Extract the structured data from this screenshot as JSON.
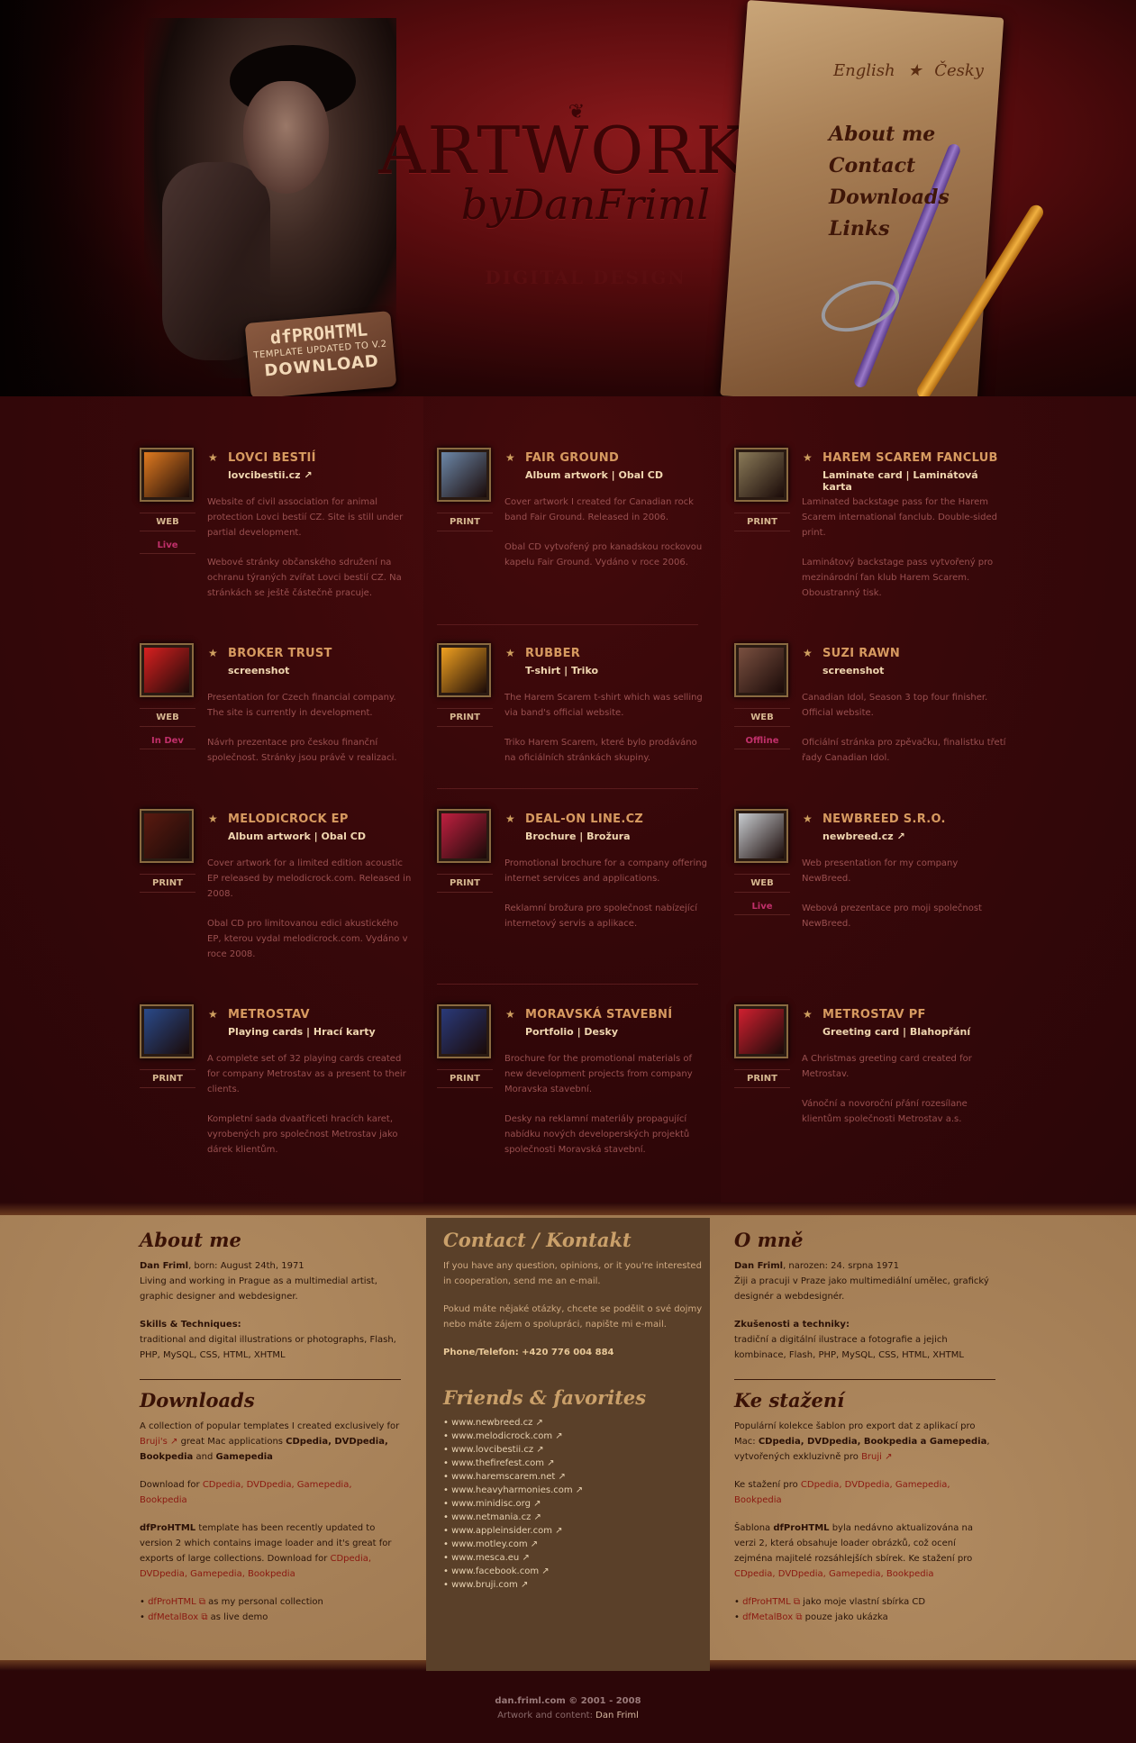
{
  "header": {
    "logo": "ARTWORKS",
    "by": "byDanFriml",
    "subtitle": "DIGITAL DESIGN",
    "tag_line1": "dfPROHTML",
    "tag_line2": "TEMPLATE UPDATED TO V.2",
    "tag_line3": "DOWNLOAD",
    "lang_en": "English",
    "lang_star": "★",
    "lang_cz": "Česky",
    "nav": [
      "About me",
      "Contact",
      "Downloads",
      "Links"
    ]
  },
  "works": [
    {
      "title": "LOVCI BESTIÍ",
      "sub": "lovcibestii.cz ↗",
      "kind": "WEB",
      "status": "Live",
      "thumb_color": "#e07a20",
      "icon": "warning-sign-icon",
      "desc": [
        "Website of civil association for animal protection Lovci bestií CZ. Site is still under partial development.",
        "Webové stránky občanského sdružení na ochranu týraných zvířat Lovci bestií CZ. Na stránkách se ještě částečně pracuje."
      ]
    },
    {
      "title": "FAIR GROUND",
      "sub": "Album artwork | Obal CD",
      "kind": "PRINT",
      "status": "",
      "thumb_color": "#6c87a8",
      "icon": "mask-icon",
      "desc": [
        "Cover artwork I created for Canadian rock band Fair Ground. Released in 2006.",
        "Obal CD vytvořený pro kanadskou rockovou kapelu Fair Ground. Vydáno v roce 2006."
      ]
    },
    {
      "title": "HAREM SCAREM FANCLUB",
      "sub": "Laminate card | Laminátová karta",
      "kind": "PRINT",
      "status": "",
      "thumb_color": "#8a7a58",
      "icon": "emblem-icon",
      "desc": [
        "Laminated backstage pass for the Harem Scarem international fanclub. Double-sided print.",
        "Laminátový backstage pass vytvořený pro mezinárodní fan klub Harem Scarem. Oboustranný tisk."
      ]
    },
    {
      "title": "BROKER TRUST",
      "sub": "screenshot",
      "kind": "WEB",
      "status": "In Dev",
      "thumb_color": "#d82020",
      "icon": "broker-logo-icon",
      "desc": [
        "Presentation for Czech financial company. The site is currently in development.",
        "Návrh prezentace pro českou finanční společnost. Stránky jsou právě v realizaci."
      ]
    },
    {
      "title": "RUBBER",
      "sub": "T-shirt | Triko",
      "kind": "PRINT",
      "status": "",
      "thumb_color": "#f0a020",
      "icon": "rubber-duck-icon",
      "desc": [
        "The Harem Scarem t-shirt which was selling via band's official website.",
        "Triko Harem Scarem, které bylo prodáváno na oficiálních stránkách skupiny."
      ]
    },
    {
      "title": "SUZI RAWN",
      "sub": "screenshot",
      "kind": "WEB",
      "status": "Offline",
      "thumb_color": "#7a5040",
      "icon": "portrait-icon",
      "desc": [
        "Canadian Idol, Season 3 top four finisher. Official website.",
        "Oficiální stránka pro zpěvačku, finalistku třetí řady Canadian Idol."
      ]
    },
    {
      "title": "MELODICROCK EP",
      "sub": "Album artwork | Obal CD",
      "kind": "PRINT",
      "status": "",
      "thumb_color": "#5a1a10",
      "icon": "ep-cover-icon",
      "desc": [
        "Cover artwork for a limited edition acoustic EP released by melodicrock.com. Released in 2008.",
        "Obal CD pro limitovanou edici akustického EP, kterou vydal melodicrock.com. Vydáno v roce 2008."
      ]
    },
    {
      "title": "DEAL-ON LINE.CZ",
      "sub": "Brochure | Brožura",
      "kind": "PRINT",
      "status": "",
      "thumb_color": "#c02040",
      "icon": "brochure-icon",
      "desc": [
        "Promotional brochure for a company offering internet services and applications.",
        "Reklamní brožura pro společnost nabízející internetový servis a aplikace."
      ]
    },
    {
      "title": "NEWBREED S.R.O.",
      "sub": "newbreed.cz ↗",
      "kind": "WEB",
      "status": "Live",
      "thumb_color": "#c8ccd0",
      "icon": "figure-icon",
      "desc": [
        "Web presentation for my company NewBreed.",
        "Webová prezentace pro moji společnost NewBreed."
      ]
    },
    {
      "title": "METROSTAV",
      "sub": "Playing cards | Hrací karty",
      "kind": "PRINT",
      "status": "",
      "thumb_color": "#2a4a8a",
      "icon": "building-icon",
      "desc": [
        "A complete set of 32 playing cards created for company Metrostav as a present to their clients.",
        "Kompletní sada dvaatřiceti hracích karet, vyrobených pro společnost Metrostav jako dárek klientům."
      ]
    },
    {
      "title": "MORAVSKÁ STAVEBNÍ",
      "sub": "Portfolio | Desky",
      "kind": "PRINT",
      "status": "",
      "thumb_color": "#2a3a7a",
      "icon": "portfolio-icon",
      "desc": [
        "Brochure for the promotional materials of new development projects from company Moravska stavební.",
        "Desky na reklamní materiály propagující nabídku nových developerských projektů společnosti Moravská stavební."
      ]
    },
    {
      "title": "METROSTAV PF",
      "sub": "Greeting card | Blahopřání",
      "kind": "PRINT",
      "status": "",
      "thumb_color": "#d02030",
      "icon": "greeting-card-icon",
      "desc": [
        "A Christmas greeting card created for Metrostav.",
        "Vánoční a novoroční přání rozesílane klientům společnosti Metrostav a.s."
      ]
    }
  ],
  "about": {
    "title": "About me",
    "name": "Dan Friml",
    "born": ", born: August 24th, 1971",
    "living": "Living and working in Prague as a multimedial artist, graphic designer and webdesigner.",
    "skills_title": "Skills & Techniques:",
    "skills": "traditional and digital illustrations or photographs, Flash, PHP, MySQL, CSS, HTML, XHTML"
  },
  "downloads": {
    "title": "Downloads",
    "p1a": "A collection of popular templates I created exclusively for ",
    "p1b": "Bruji's ↗",
    "p1c": " great Mac applications ",
    "p1d": "CDpedia, DVDpedia, Bookpedia",
    "p1e": " and ",
    "p1f": "Gamepedia",
    "p2": "Download for ",
    "p2links": "CDpedia, DVDpedia, Gamepedia, Bookpedia",
    "p3a": "dfProHTML",
    "p3b": " template has been recently updated to version 2 which contains image loader and it's great for exports of large collections. Download for ",
    "p3links": "CDpedia, DVDpedia, Gamepedia, Bookpedia",
    "li1a": "dfProHTML ⧉",
    "li1b": " as my personal collection",
    "li2a": "dfMetalBox ⧉",
    "li2b": " as live demo"
  },
  "contact": {
    "title": "Contact / Kontakt",
    "p1": "If you have any question, opinions, or it you're interested in cooperation, send me an e-mail.",
    "p2": "Pokud máte nějaké otázky, chcete se podělit o své dojmy nebo máte zájem o spolupráci, napište mi e-mail.",
    "phone": "Phone/Telefon: +420 776 004 884"
  },
  "friends": {
    "title": "Friends & favorites",
    "links": [
      "www.newbreed.cz ↗",
      "www.melodicrock.com ↗",
      "www.lovcibestii.cz ↗",
      "www.thefirefest.com ↗",
      "www.haremscarem.net ↗",
      "www.heavyharmonies.com ↗",
      "www.minidisc.org ↗",
      "www.netmania.cz ↗",
      "www.appleinsider.com ↗",
      "www.motley.com ↗",
      "www.mesca.eu ↗",
      "www.facebook.com ↗",
      "www.bruji.com ↗"
    ]
  },
  "omne": {
    "title": "O mně",
    "name": "Dan Friml",
    "born": ", narozen: 24. srpna 1971",
    "living": "Žiji a pracuji v Praze jako multimediální umělec, grafický designér a webdesignér.",
    "skills_title": "Zkušenosti a techniky:",
    "skills": "tradiční a digitální ilustrace a fotografie a jejich kombinace, Flash, PHP, MySQL, CSS, HTML, XHTML"
  },
  "kestazeni": {
    "title": "Ke stažení",
    "p1a": "Populární kolekce šablon pro export dat z aplikací pro Mac: ",
    "p1b": "CDpedia, DVDpedia, Bookpedia a Gamepedia",
    "p1c": ", vytvořených exkluzivně pro ",
    "p1d": "Bruji ↗",
    "p2": "Ke stažení pro ",
    "p2links": "CDpedia, DVDpedia, Gamepedia, Bookpedia",
    "p3a": "Šablona ",
    "p3b": "dfProHTML",
    "p3c": " byla nedávno aktualizována na verzi 2, která obsahuje loader obrázků, což ocení zejména majitelé rozsáhlejších sbírek. Ke stažení pro ",
    "p3links": "CDpedia, DVDpedia, Gamepedia, Bookpedia",
    "li1a": "dfProHTML ⧉",
    "li1b": " jako moje vlastní sbírka CD",
    "li2a": "dfMetalBox ⧉",
    "li2b": " pouze jako ukázka"
  },
  "footer": {
    "line1": "dan.friml.com © 2001 - 2008",
    "line2a": "Artwork and content: ",
    "line2b": "Dan Friml"
  }
}
